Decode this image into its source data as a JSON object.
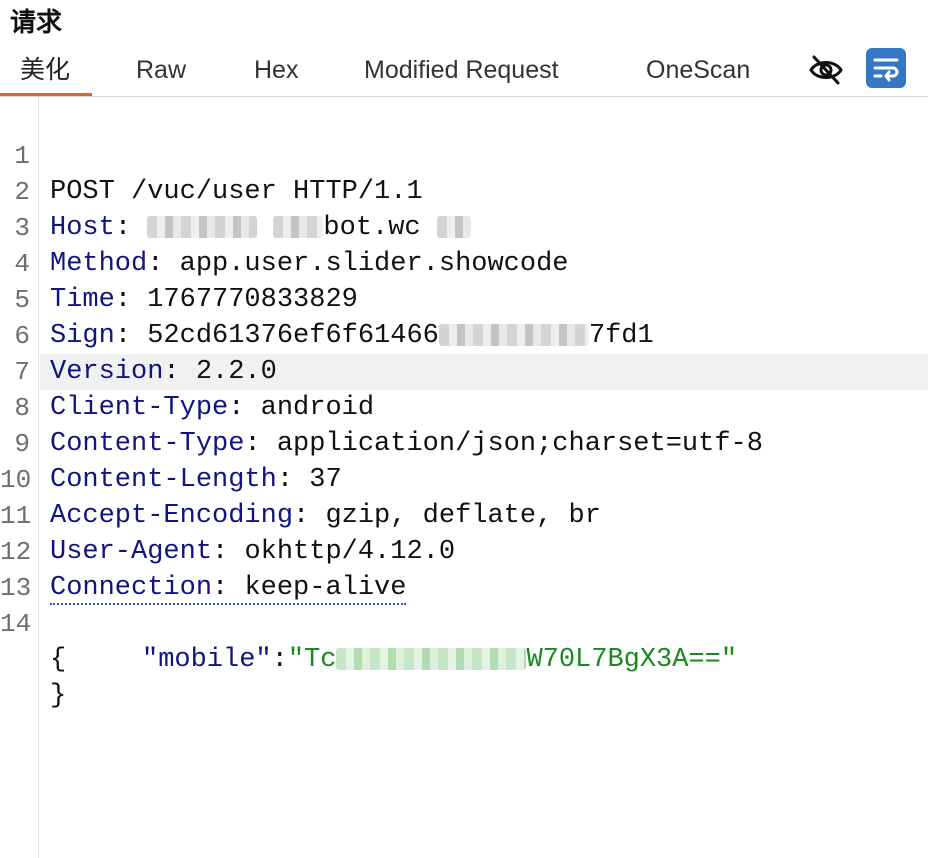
{
  "panel": {
    "title": "请求"
  },
  "tabs": [
    {
      "label": "美化",
      "active": true
    },
    {
      "label": "Raw"
    },
    {
      "label": "Hex"
    },
    {
      "label": "Modified Request"
    },
    {
      "label": "OneScan"
    }
  ],
  "toolbar": {
    "hide_icon": "eye-slash-icon",
    "wrap_icon": "wrap-lines-icon",
    "accent_color": "#3577c4"
  },
  "editor": {
    "highlighted_line": 6,
    "lines": {
      "l1": {
        "n": "1",
        "text": "POST /vuc/user HTTP/1.1"
      },
      "l2": {
        "n": "2",
        "name": "Host",
        "value_visible": "bot.wc"
      },
      "l3": {
        "n": "3",
        "name": "Method",
        "value": "app.user.slider.showcode"
      },
      "l4": {
        "n": "4",
        "name": "Time",
        "value": "1767770833829"
      },
      "l5": {
        "n": "5",
        "name": "Sign",
        "value_start": "52cd61376ef6f61466",
        "value_end": "7fd1"
      },
      "l6": {
        "n": "6",
        "name": "Version",
        "value": "2.2.0"
      },
      "l7": {
        "n": "7",
        "name": "Client-Type",
        "value": "android"
      },
      "l8": {
        "n": "8",
        "name": "Content-Type",
        "value": "application/json;charset=utf-8"
      },
      "l9": {
        "n": "9",
        "name": "Content-Length",
        "value": "37"
      },
      "l10": {
        "n": "10",
        "name": "Accept-Encoding",
        "value": "gzip, deflate, br"
      },
      "l11": {
        "n": "11",
        "name": "User-Agent",
        "value": "okhttp/4.12.0"
      },
      "l12": {
        "n": "12",
        "name": "Connection",
        "value": "keep-alive"
      },
      "l13": {
        "n": "13"
      },
      "l14": {
        "n": "14",
        "text": "{"
      },
      "l15": {
        "key": "\"mobile\"",
        "value_start": "\"Tc",
        "value_end": "W70L7BgX3A==\""
      },
      "l16": {
        "text": "}"
      }
    }
  }
}
